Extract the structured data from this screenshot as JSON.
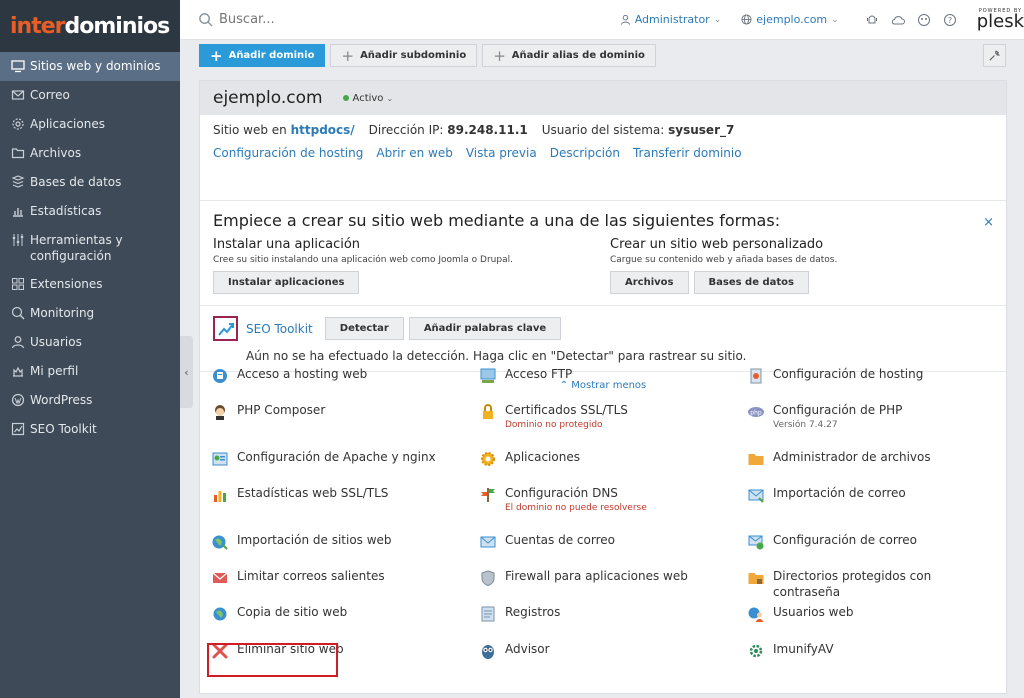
{
  "brand": {
    "part1": "inter",
    "part2": "dominios"
  },
  "sidebar": {
    "items": [
      {
        "label": "Sitios web y dominios",
        "icon": "monitor-icon",
        "active": true
      },
      {
        "label": "Correo",
        "icon": "mail-icon"
      },
      {
        "label": "Aplicaciones",
        "icon": "gear-icon"
      },
      {
        "label": "Archivos",
        "icon": "folder-icon"
      },
      {
        "label": "Bases de datos",
        "icon": "database-icon"
      },
      {
        "label": "Estadísticas",
        "icon": "bar-chart-icon"
      },
      {
        "label": "Herramientas y configuración",
        "icon": "tools-icon"
      },
      {
        "label": "Extensiones",
        "icon": "extensions-icon"
      },
      {
        "label": "Monitoring",
        "icon": "monitoring-icon"
      },
      {
        "label": "Usuarios",
        "icon": "user-icon"
      },
      {
        "label": "Mi perfil",
        "icon": "profile-icon"
      },
      {
        "label": "WordPress",
        "icon": "wordpress-icon"
      },
      {
        "label": "SEO Toolkit",
        "icon": "seo-toolkit-icon"
      }
    ]
  },
  "topbar": {
    "search_placeholder": "Buscar...",
    "user": "Administrator",
    "subscription": "ejemplo.com",
    "plesk_powered": "POWERED BY",
    "plesk_name": "plesk"
  },
  "toolbar": {
    "add_domain": "Añadir dominio",
    "add_subdomain": "Añadir subdominio",
    "add_alias": "Añadir alias de dominio"
  },
  "domain": {
    "name": "ejemplo.com",
    "status": "Activo",
    "site_prefix": "Sitio web en",
    "site_dir": "httpdocs/",
    "ip_label": "Dirección IP:",
    "ip": "89.248.11.1",
    "sysuser_label": "Usuario del sistema:",
    "sysuser": "sysuser_7",
    "links": [
      "Configuración de hosting",
      "Abrir en web",
      "Vista previa",
      "Descripción",
      "Transferir dominio"
    ]
  },
  "start": {
    "title": "Empiece a crear su sitio web mediante a una de las siguientes formas:",
    "app_title": "Instalar una aplicación",
    "app_desc": "Cree su sitio instalando una aplicación web como Joomla o Drupal.",
    "app_button": "Instalar aplicaciones",
    "custom_title": "Crear un sitio web personalizado",
    "custom_desc": "Cargue su contenido web y añada bases de datos.",
    "files_button": "Archivos",
    "db_button": "Bases de datos",
    "close": "×"
  },
  "seo": {
    "name": "SEO Toolkit",
    "detect": "Detectar",
    "add_keywords": "Añadir palabras clave",
    "message": "Aún no se ha efectuado la detección. Haga clic en \"Detectar\" para rastrear su sitio."
  },
  "show_less": "Mostrar menos",
  "tools": [
    {
      "label": "Acceso a hosting web",
      "icon": "hosting-access-icon"
    },
    {
      "label": "Acceso FTP",
      "icon": "ftp-icon"
    },
    {
      "label": "Configuración de hosting",
      "icon": "hosting-settings-icon"
    },
    {
      "label": "PHP Composer",
      "icon": "php-composer-icon"
    },
    {
      "label": "Certificados SSL/TLS",
      "icon": "ssl-lock-icon",
      "sub": "Dominio no protegido",
      "sub_style": "red"
    },
    {
      "label": "Configuración de PHP",
      "icon": "php-icon",
      "sub": "Versión 7.4.27",
      "sub_style": "gray"
    },
    {
      "label": "Configuración de Apache y nginx",
      "icon": "apache-nginx-icon"
    },
    {
      "label": "Aplicaciones",
      "icon": "applications-gear-icon"
    },
    {
      "label": "Administrador de archivos",
      "icon": "file-manager-icon"
    },
    {
      "label": "Estadísticas web SSL/TLS",
      "icon": "web-stats-icon"
    },
    {
      "label": "Configuración DNS",
      "icon": "dns-icon",
      "sub": "El dominio no puede resolverse",
      "sub_style": "red"
    },
    {
      "label": "Importación de correo",
      "icon": "mail-import-icon"
    },
    {
      "label": "Importación de sitios web",
      "icon": "site-import-icon"
    },
    {
      "label": "Cuentas de correo",
      "icon": "mail-accounts-icon"
    },
    {
      "label": "Configuración de correo",
      "icon": "mail-settings-icon"
    },
    {
      "label": "Limitar correos salientes",
      "icon": "outgoing-mail-icon"
    },
    {
      "label": "Firewall para aplicaciones web",
      "icon": "firewall-shield-icon"
    },
    {
      "label": "Directorios protegidos con contraseña",
      "icon": "protected-dirs-icon"
    },
    {
      "label": "Copia de sitio web",
      "icon": "site-copy-icon"
    },
    {
      "label": "Registros",
      "icon": "logs-icon"
    },
    {
      "label": "Usuarios web",
      "icon": "web-users-icon"
    },
    {
      "label": "Eliminar sitio web",
      "icon": "delete-x-icon"
    },
    {
      "label": "Advisor",
      "icon": "advisor-owl-icon"
    },
    {
      "label": "ImunifyAV",
      "icon": "imunify-icon"
    }
  ],
  "colors": {
    "accent": "#2b9ad8",
    "sidebar": "#3e4a57",
    "highlight": "#cf1d25",
    "error": "#c0392b"
  }
}
